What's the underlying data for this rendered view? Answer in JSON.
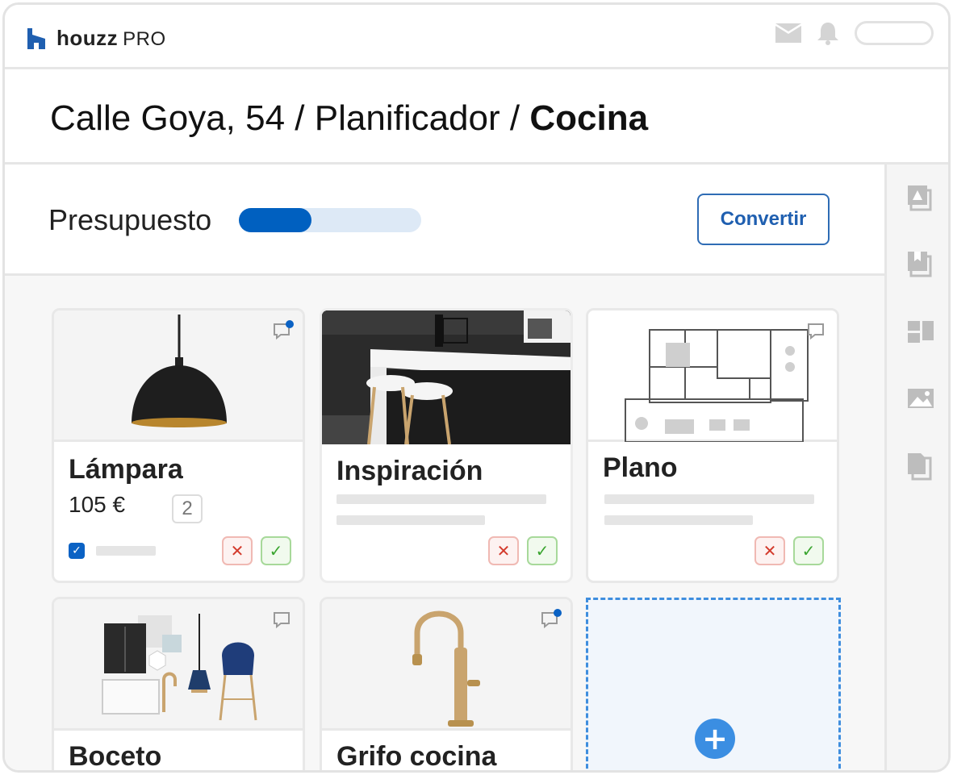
{
  "app": {
    "brand": "houzz",
    "brand_suffix": "PRO"
  },
  "breadcrumb": {
    "project": "Calle Goya, 54",
    "section": "Planificador",
    "current": "Cocina",
    "separator": " / "
  },
  "budget": {
    "label": "Presupuesto",
    "progress_fraction": 0.4,
    "convert_label": "Convertir"
  },
  "cards": [
    {
      "title": "Lámpara",
      "price": "105 €",
      "quantity": "2",
      "has_new_comment": true
    },
    {
      "title": "Inspiración",
      "has_new_comment": false
    },
    {
      "title": "Plano",
      "has_new_comment": false
    },
    {
      "title": "Boceto",
      "has_new_comment": false
    },
    {
      "title": "Grifo cocina",
      "has_new_comment": true
    }
  ],
  "actions": {
    "reject_glyph": "✕",
    "accept_glyph": "✓",
    "add_glyph": "+"
  },
  "colors": {
    "accent": "#0060c0",
    "reject": "#d33a2c",
    "accept": "#3aa530",
    "unread_dot": "#0b62c4"
  },
  "icons": {
    "top": [
      "mail-icon",
      "bell-icon"
    ],
    "rail": [
      "estimate-icon",
      "bookmark-icon",
      "moodboard-icon",
      "image-icon",
      "document-icon"
    ]
  }
}
